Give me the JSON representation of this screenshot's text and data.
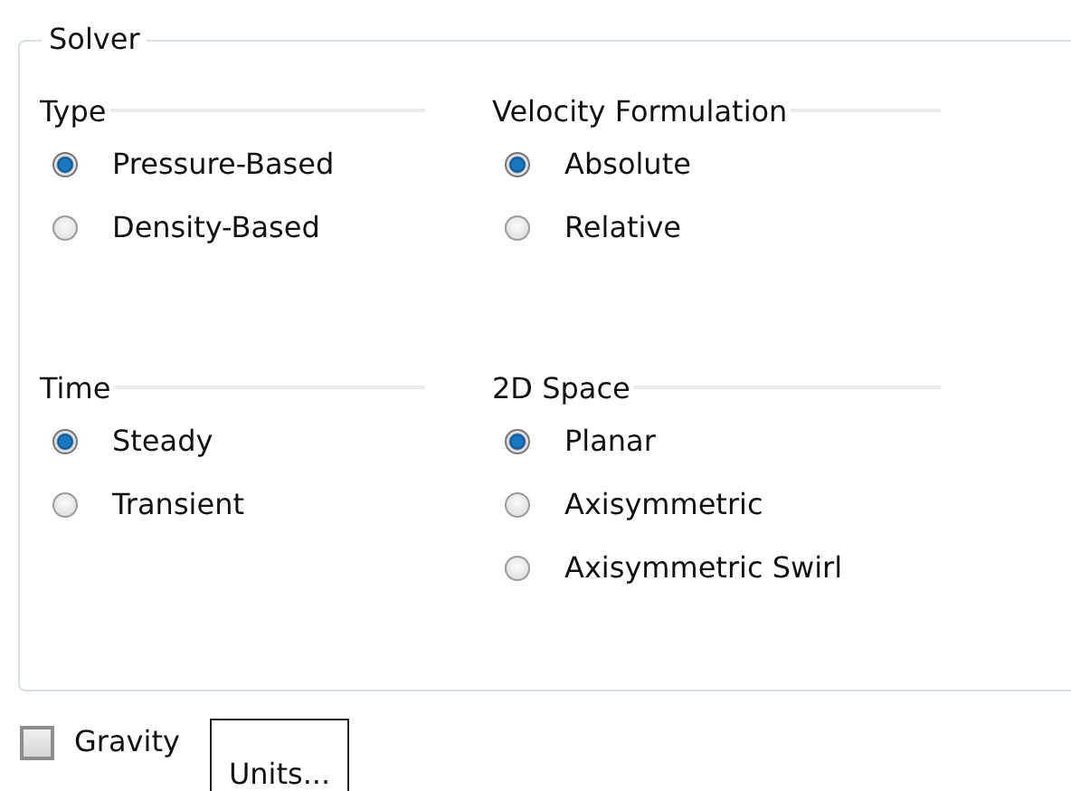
{
  "solver": {
    "title": "Solver",
    "rows": [
      [
        {
          "title": "Type",
          "options": [
            {
              "label": "Pressure-Based",
              "selected": true
            },
            {
              "label": "Density-Based",
              "selected": false
            }
          ]
        },
        {
          "title": "Velocity Formulation",
          "options": [
            {
              "label": "Absolute",
              "selected": true
            },
            {
              "label": "Relative",
              "selected": false
            }
          ]
        }
      ],
      [
        {
          "title": "Time",
          "options": [
            {
              "label": "Steady",
              "selected": true
            },
            {
              "label": "Transient",
              "selected": false
            }
          ]
        },
        {
          "title": "2D Space",
          "options": [
            {
              "label": "Planar",
              "selected": true
            },
            {
              "label": "Axisymmetric",
              "selected": false
            },
            {
              "label": "Axisymmetric Swirl",
              "selected": false
            }
          ]
        }
      ]
    ]
  },
  "gravity": {
    "label": "Gravity",
    "checked": false
  },
  "buttons": [
    {
      "label": "Units..."
    }
  ]
}
